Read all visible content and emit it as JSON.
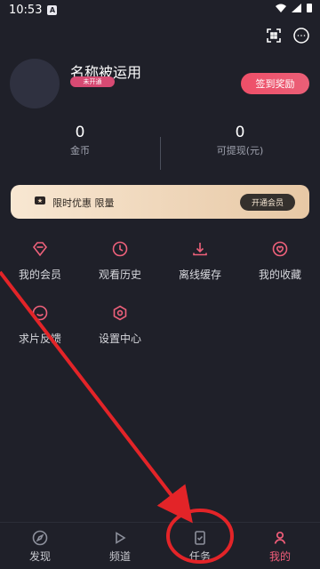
{
  "status_bar": {
    "time": "10:53",
    "app_icon": "A"
  },
  "top_actions": {
    "scan_icon": "scan-icon",
    "more_icon": "more-icon"
  },
  "profile": {
    "name": "名称被运用",
    "badge": "未开通",
    "checkin_label": "签到奖励"
  },
  "stats": [
    {
      "value": "0",
      "label": "金币"
    },
    {
      "value": "0",
      "label": "可提现(元)"
    }
  ],
  "vip_banner": {
    "text": "限时优惠 限量",
    "button": "开通会员"
  },
  "menu": [
    {
      "label": "我的会员",
      "icon": "diamond-icon"
    },
    {
      "label": "观看历史",
      "icon": "clock-icon"
    },
    {
      "label": "离线缓存",
      "icon": "download-icon"
    },
    {
      "label": "我的收藏",
      "icon": "heart-icon"
    },
    {
      "label": "求片反馈",
      "icon": "smile-icon"
    },
    {
      "label": "设置中心",
      "icon": "settings-icon"
    }
  ],
  "bottom_nav": [
    {
      "label": "发现",
      "icon": "compass-icon"
    },
    {
      "label": "频道",
      "icon": "play-icon"
    },
    {
      "label": "任务",
      "icon": "task-icon"
    },
    {
      "label": "我的",
      "icon": "user-icon",
      "active": true
    }
  ],
  "colors": {
    "background": "#1f2029",
    "accent": "#f15d79",
    "vip_gold": "#f8e7d2",
    "annotation_red": "#e32428"
  }
}
